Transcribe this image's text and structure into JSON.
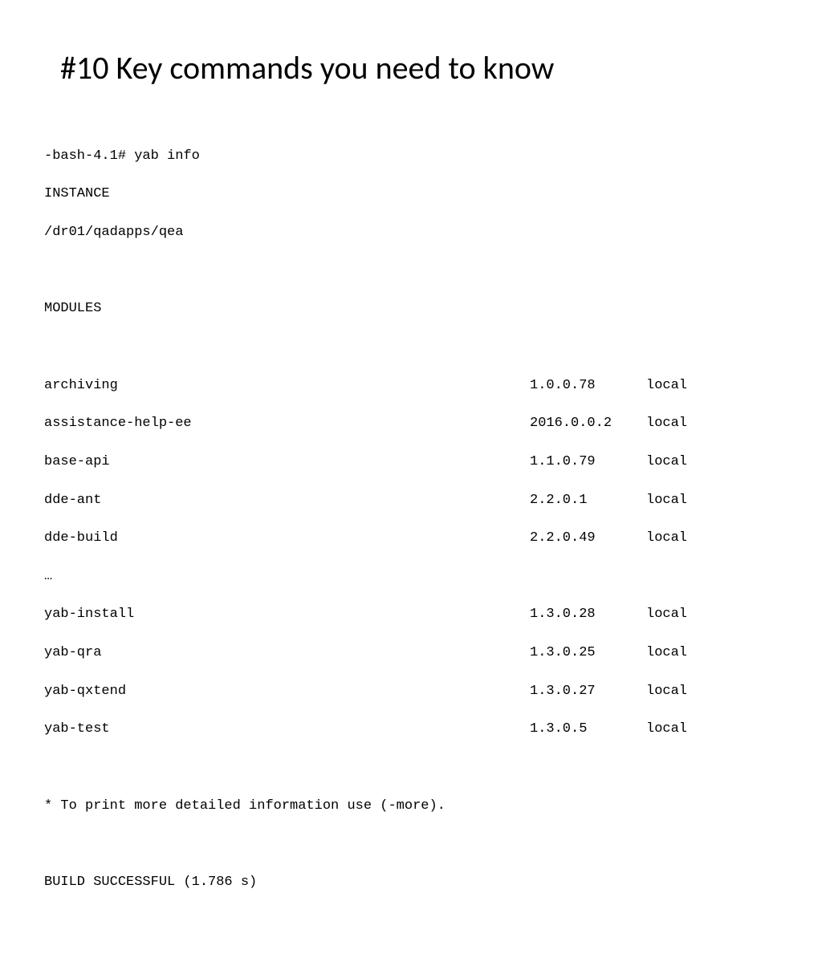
{
  "title": "#10 Key commands you need to know",
  "prompt": "-bash-4.1# yab info",
  "instance_label": "INSTANCE",
  "instance_path": "/dr01/qadapps/qea",
  "modules_label": "MODULES",
  "modules_top": [
    {
      "name": "archiving",
      "version": "1.0.0.78",
      "source": "local"
    },
    {
      "name": "assistance-help-ee",
      "version": "2016.0.0.2",
      "source": "local"
    },
    {
      "name": "base-api",
      "version": "1.1.0.79",
      "source": "local"
    },
    {
      "name": "dde-ant",
      "version": "2.2.0.1",
      "source": "local"
    },
    {
      "name": "dde-build",
      "version": "2.2.0.49",
      "source": "local"
    }
  ],
  "ellipsis": "…",
  "modules_bottom": [
    {
      "name": "yab-install",
      "version": "1.3.0.28",
      "source": "local"
    },
    {
      "name": "yab-qra",
      "version": "1.3.0.25",
      "source": "local"
    },
    {
      "name": "yab-qxtend",
      "version": "1.3.0.27",
      "source": "local"
    },
    {
      "name": "yab-test",
      "version": "1.3.0.5",
      "source": "local"
    }
  ],
  "note": "* To print more detailed information use (-more).",
  "build_status": "BUILD SUCCESSFUL (1.786 s)"
}
